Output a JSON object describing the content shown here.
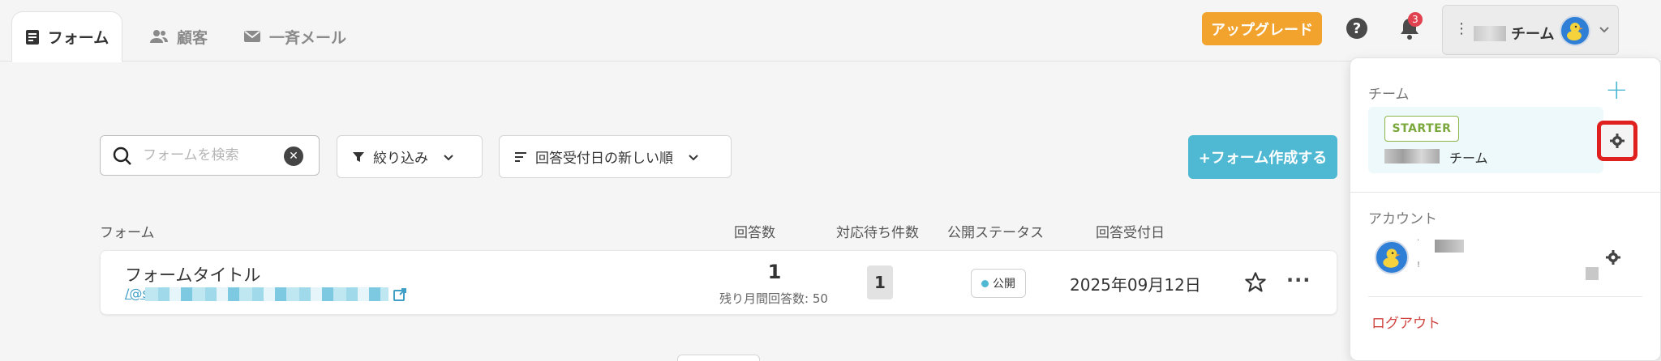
{
  "nav": {
    "tabs": [
      {
        "label": "フォーム",
        "icon": "form-icon",
        "active": true
      },
      {
        "label": "顧客",
        "icon": "users-icon",
        "active": false
      },
      {
        "label": "一斉メール",
        "icon": "mail-icon",
        "active": false
      }
    ],
    "upgrade_label": "アップグレード",
    "help_label": "?",
    "notification_count": "3",
    "team_switcher": {
      "name": "チーム",
      "dots": "⋮"
    }
  },
  "toolbar": {
    "search_placeholder": "フォームを検索",
    "search_value": "",
    "filter_label": "絞り込み",
    "sort_label": "回答受付日の新しい順",
    "create_label": "+フォーム作成する"
  },
  "table": {
    "headers": {
      "form": "フォーム",
      "responses": "回答数",
      "pending": "対応待ち件数",
      "status": "公開ステータス",
      "date": "回答受付日"
    },
    "rows": [
      {
        "title": "フォームタイトル",
        "link_prefix": "/@s",
        "responses": "1",
        "remaining": "残り月間回答数: 50",
        "pending": "1",
        "status": "公開",
        "date": "2025年09月12日",
        "more": "···"
      }
    ]
  },
  "panel": {
    "team_section_title": "チーム",
    "add_label": "+",
    "plan_badge": "STARTER",
    "team_name": "チーム",
    "account_section_title": "アカウント",
    "account_dot1": "·",
    "account_dot2": "!",
    "logout_label": "ログアウト"
  },
  "colors": {
    "accent": "#4fb8d2",
    "upgrade": "#f2a32e",
    "highlight": "#e01f1f",
    "logout": "#d0443f",
    "badge": "#e0434f"
  }
}
